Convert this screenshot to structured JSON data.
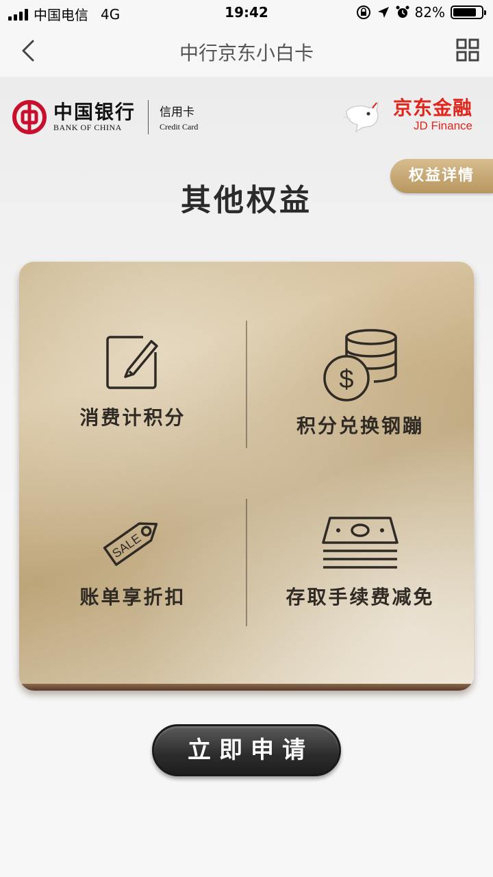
{
  "status_bar": {
    "carrier": "中国电信",
    "network": "4G",
    "time": "19:42",
    "battery_percent": "82%",
    "battery_level": 0.82
  },
  "nav": {
    "title": "中行京东小白卡"
  },
  "logos": {
    "boc_cn": "中国银行",
    "boc_en": "BANK OF CHINA",
    "boc_card_cn": "信用卡",
    "boc_card_en": "Credit Card",
    "jd_cn": "京东金融",
    "jd_en": "JD Finance"
  },
  "details_tab": "权益详情",
  "section_title": "其他权益",
  "benefits": [
    {
      "label": "消费计积分",
      "icon": "edit-icon"
    },
    {
      "label": "积分兑换钢蹦",
      "icon": "coin-stack-icon"
    },
    {
      "label": "账单享折扣",
      "icon": "sale-tag-icon",
      "tag_text": "SALE"
    },
    {
      "label": "存取手续费减免",
      "icon": "cash-stack-icon"
    }
  ],
  "apply_button": "立即申请",
  "colors": {
    "jd_red": "#e1251b",
    "boc_red": "#c8102e",
    "gold": "#c9b48b"
  }
}
